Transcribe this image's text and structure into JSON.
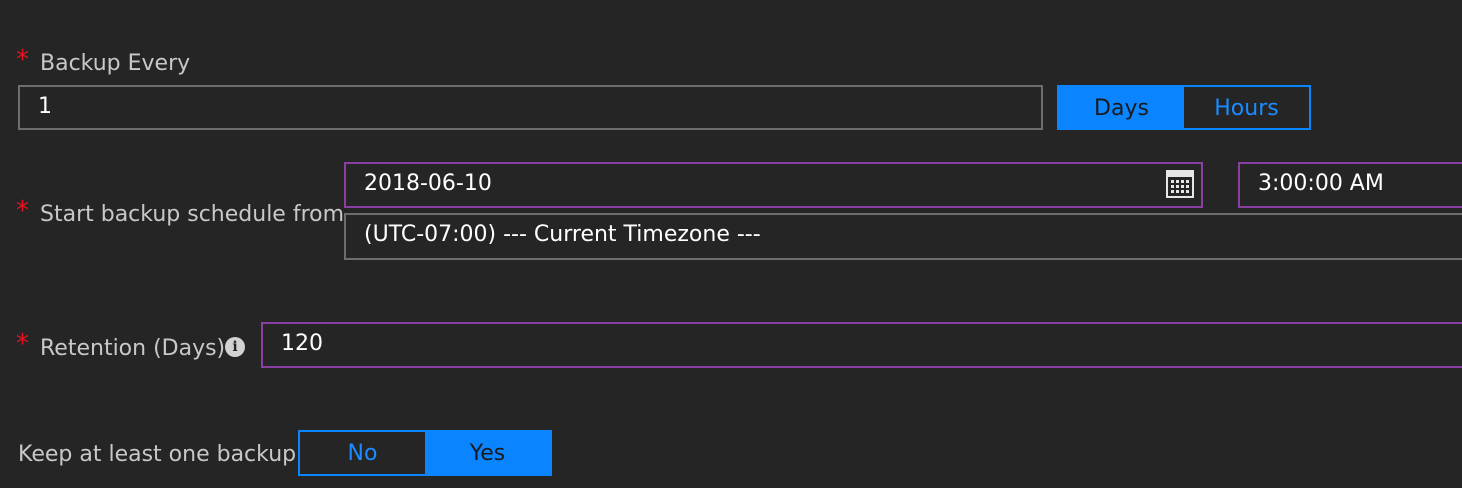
{
  "backup_every": {
    "required_mark": "*",
    "label": "Backup Every",
    "value": "1",
    "units": {
      "options": [
        "Days",
        "Hours"
      ],
      "selected": "Days"
    }
  },
  "start_schedule": {
    "required_mark": "*",
    "label": "Start backup schedule from",
    "date_value": "2018-06-10",
    "time_value": "3:00:00 AM",
    "timezone_value": "(UTC-07:00) --- Current Timezone ---",
    "calendar_icon": "calendar-icon"
  },
  "retention": {
    "required_mark": "*",
    "label": "Retention (Days)",
    "info_icon": "info-icon",
    "info_glyph": "i",
    "value": "120"
  },
  "keep_one_backup": {
    "label": "Keep at least one backup",
    "options": [
      "No",
      "Yes"
    ],
    "selected": "Yes"
  },
  "colors": {
    "background": "#252526",
    "accent": "#0a84ff",
    "required": "#e81123",
    "focus_border": "#8a3fa3",
    "input_border": "#6d6d6d"
  }
}
